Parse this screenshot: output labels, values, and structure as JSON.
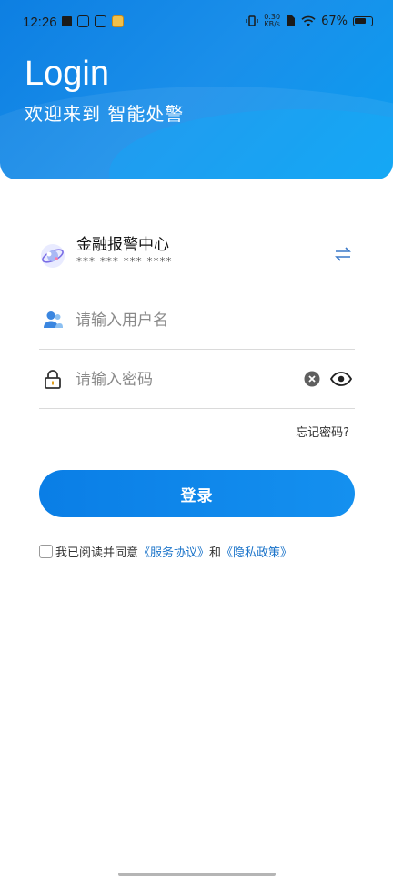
{
  "status_bar": {
    "time": "12:26",
    "speed_value": "0.30",
    "speed_unit": "KB/s",
    "battery": "67%"
  },
  "header": {
    "title": "Login",
    "subtitle": "欢迎来到 智能处警"
  },
  "org": {
    "name": "金融报警中心",
    "phone": "*** *** *** ****"
  },
  "username": {
    "placeholder": "请输入用户名",
    "value": ""
  },
  "password": {
    "placeholder": "请输入密码",
    "value": ""
  },
  "forgot_label": "忘记密码?",
  "login_button_label": "登录",
  "agreement": {
    "prefix": "我已阅读并同意",
    "service_link": "《服务协议》",
    "and": "和",
    "privacy_link": "《隐私政策》"
  },
  "colors": {
    "brand_blue": "#0d7fe2",
    "link_blue": "#1a73c9"
  },
  "icons": [
    "app-notification-icon",
    "vibrate-icon",
    "wifi-icon",
    "battery-icon",
    "alarm-center-logo",
    "switch-arrows-icon",
    "user-icon",
    "lock-icon",
    "clear-icon",
    "eye-icon"
  ]
}
